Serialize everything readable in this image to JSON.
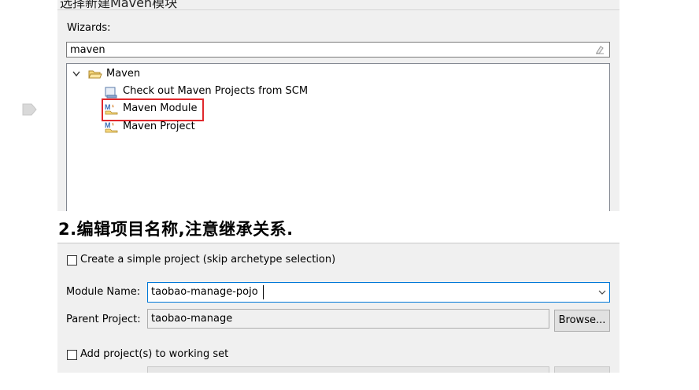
{
  "wizard_panel": {
    "top_partial_text": "选择新建Maven模块",
    "wizards_label": "Wizards:",
    "filter_value": "maven",
    "tree": {
      "group_label": "Maven",
      "items": [
        {
          "label": "Check out Maven Projects from SCM",
          "icon": "scm-checkout-icon"
        },
        {
          "label": "Maven Module",
          "icon": "maven-module-icon",
          "highlighted": true
        },
        {
          "label": "Maven Project",
          "icon": "maven-project-icon"
        }
      ]
    }
  },
  "step_heading": "2.编辑项目名称,注意继承关系.",
  "module_panel": {
    "simple_project_label": "Create a simple project (skip archetype selection)",
    "module_name_label": "Module Name:",
    "module_name_value": "taobao-manage-pojo",
    "parent_project_label": "Parent Project:",
    "parent_project_value": "taobao-manage",
    "browse_label": "Browse...",
    "working_set_label": "Add project(s) to working set"
  },
  "colors": {
    "highlight_border": "#e0282c",
    "panel_bg": "#f0f0f0",
    "focus_border": "#0078d7"
  }
}
